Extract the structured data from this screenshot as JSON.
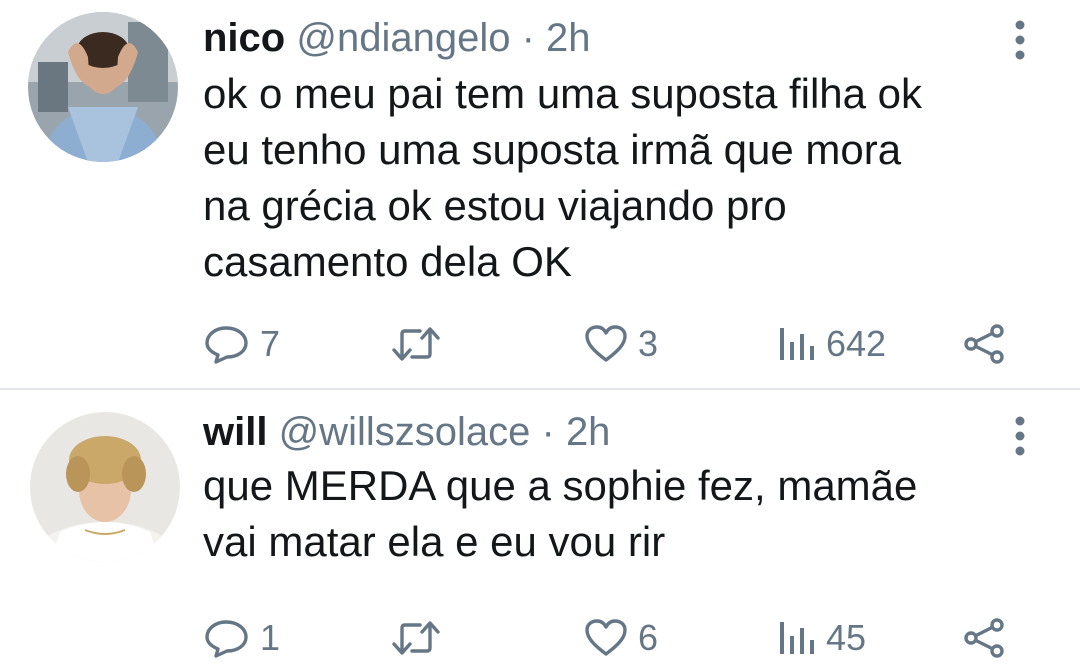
{
  "tweets": [
    {
      "name": "nico",
      "handle": "@ndiangelo",
      "separator": "·",
      "time": "2h",
      "text": "ok o meu pai tem uma suposta filha ok\neu tenho uma suposta irmã que mora\nna grécia ok estou viajando pro\ncasamento dela OK",
      "replies": "7",
      "retweets": "",
      "likes": "3",
      "views": "642"
    },
    {
      "name": "will",
      "handle": "@willszsolace",
      "separator": "·",
      "time": "2h",
      "text": "que MERDA que a sophie fez, mamãe\nvai matar ela e eu vou rir",
      "replies": "1",
      "retweets": "",
      "likes": "6",
      "views": "45"
    }
  ],
  "icons": {
    "reply": "reply-icon",
    "retweet": "retweet-icon",
    "like": "heart-icon",
    "views": "views-icon",
    "share": "share-icon",
    "more": "more-vertical-icon"
  },
  "colors": {
    "text": "#14171a",
    "muted": "#657786",
    "divider": "#e1e6ea"
  }
}
